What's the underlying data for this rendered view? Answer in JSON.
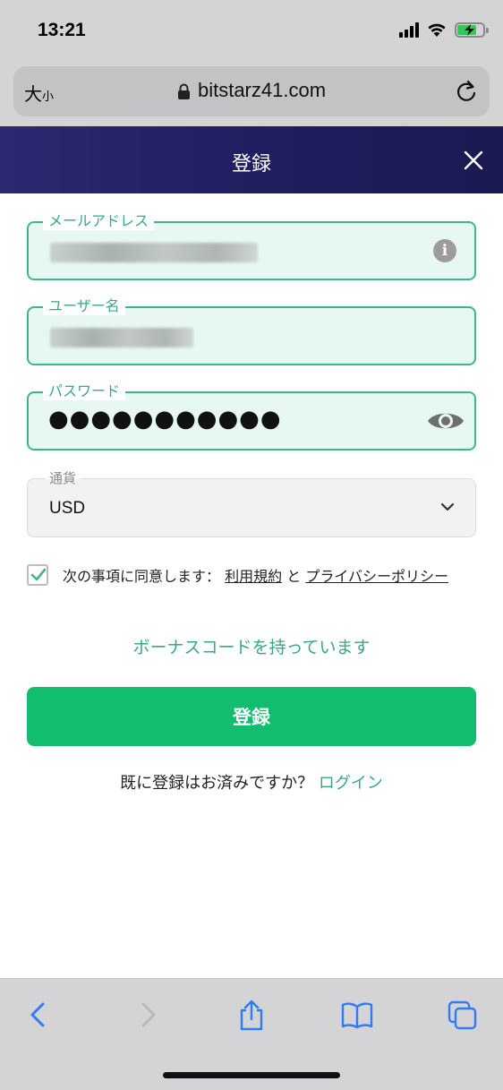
{
  "status_bar": {
    "time": "13:21"
  },
  "browser": {
    "text_size_label_big": "大",
    "text_size_label_small": "小",
    "url": "bitstarz41.com"
  },
  "modal": {
    "title": "登録",
    "email": {
      "label": "メールアドレス"
    },
    "username": {
      "label": "ユーザー名"
    },
    "password": {
      "label": "パスワード",
      "value": "●●●●●●●●●●●"
    },
    "currency": {
      "label": "通貨",
      "selected": "USD"
    },
    "terms": {
      "prefix": "次の事項に同意します：",
      "terms_link": "利用規約",
      "conjunction": "と",
      "privacy_link": "プライバシーポリシー",
      "checked": true
    },
    "bonus_code_link": "ボーナスコードを持っています",
    "register_button": "登録",
    "login_prompt": "既に登録はお済みですか？",
    "login_link": "ログイン"
  },
  "colors": {
    "header_bg": "#2b2972",
    "accent_green": "#13bd70",
    "field_bg": "#e6f8f1",
    "field_border": "#3fb58c",
    "link_color": "#3aa882",
    "ios_blue": "#2f7cf6"
  },
  "icons": {
    "status": [
      "signal-icon",
      "wifi-icon",
      "battery-charging-icon"
    ],
    "toolbar": [
      "back-icon",
      "forward-icon",
      "share-icon",
      "bookmarks-icon",
      "tabs-icon"
    ]
  }
}
